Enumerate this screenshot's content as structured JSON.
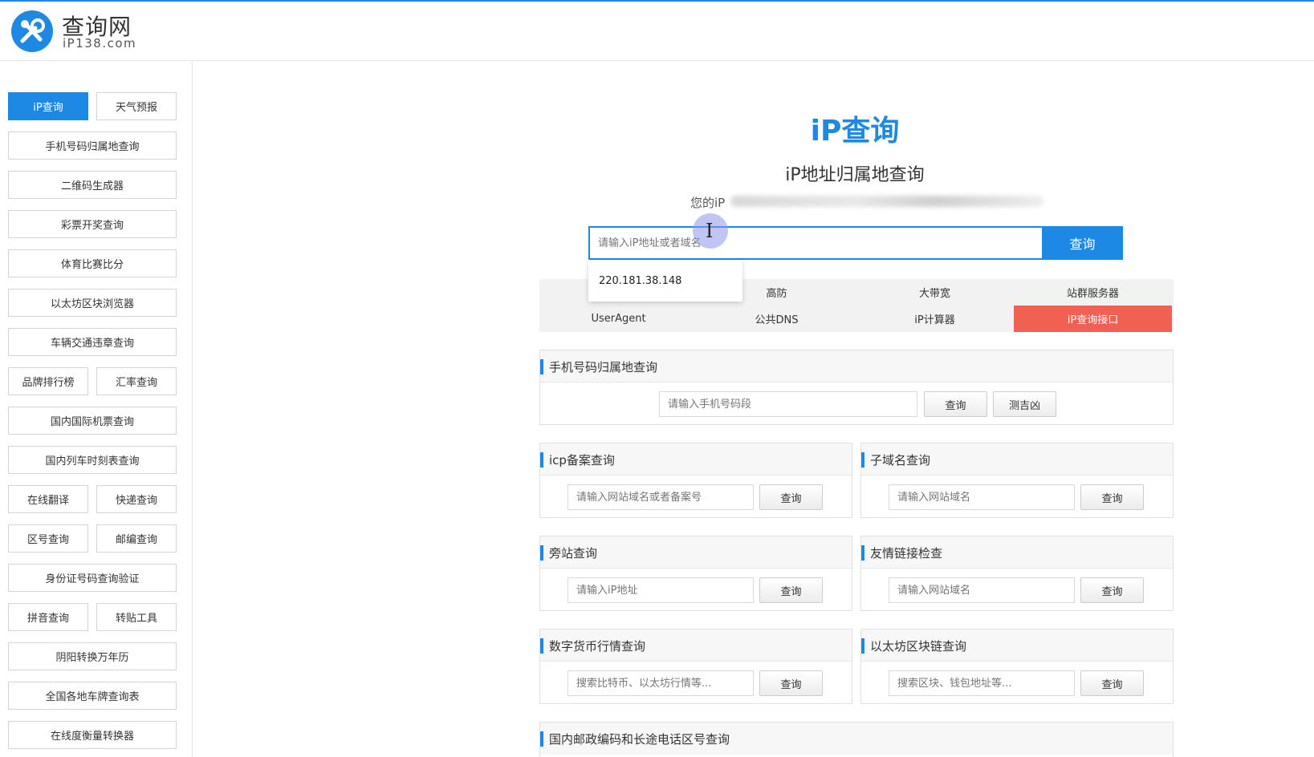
{
  "colors": {
    "accent": "#1e88e5",
    "highlight": "#f16152"
  },
  "header": {
    "site_name": "查询网",
    "site_domain": "iP138.com"
  },
  "sidebar": {
    "items": [
      {
        "label": "iP查询",
        "active": true
      },
      {
        "label": "天气预报"
      },
      {
        "label": "手机号码归属地查询"
      },
      {
        "label": "二维码生成器"
      },
      {
        "label": "彩票开奖查询"
      },
      {
        "label": "体育比赛比分"
      },
      {
        "label": "以太坊区块浏览器"
      },
      {
        "label": "车辆交通违章查询"
      },
      {
        "label": "品牌排行榜"
      },
      {
        "label": "汇率查询"
      },
      {
        "label": "国内国际机票查询"
      },
      {
        "label": "国内列车时刻表查询"
      },
      {
        "label": "在线翻译"
      },
      {
        "label": "快递查询"
      },
      {
        "label": "区号查询"
      },
      {
        "label": "邮编查询"
      },
      {
        "label": "身份证号码查询验证"
      },
      {
        "label": "拼音查询"
      },
      {
        "label": "转贴工具"
      },
      {
        "label": "阴阳转换万年历"
      },
      {
        "label": "全国各地车牌查询表"
      },
      {
        "label": "在线度衡量转换器"
      }
    ]
  },
  "main": {
    "title": "iP查询",
    "subtitle": "iP地址归属地查询",
    "your_ip_label": "您的iP",
    "search": {
      "placeholder": "请输入iP地址或者域名",
      "value": "",
      "button": "查询"
    },
    "suggestion": "220.181.38.148",
    "quick_links": {
      "row1": [
        "高防",
        "大带宽",
        "站群服务器"
      ],
      "row2": [
        "UserAgent",
        "公共DNS",
        "iP计算器",
        "iP查询接口"
      ]
    },
    "panels": {
      "phone": {
        "title": "手机号码归属地查询",
        "placeholder": "请输入手机号码段",
        "btn1": "查询",
        "btn2": "测吉凶"
      },
      "icp": {
        "title": "icp备案查询",
        "placeholder": "请输入网站域名或者备案号",
        "btn": "查询"
      },
      "subdomain": {
        "title": "子域名查询",
        "placeholder": "请输入网站域名",
        "btn": "查询"
      },
      "sidesite": {
        "title": "旁站查询",
        "placeholder": "请输入iP地址",
        "btn": "查询"
      },
      "links": {
        "title": "友情链接检查",
        "placeholder": "请输入网站域名",
        "btn": "查询"
      },
      "crypto": {
        "title": "数字货币行情查询",
        "placeholder": "搜索比特币、以太坊行情等...",
        "btn": "查询"
      },
      "eth": {
        "title": "以太坊区块链查询",
        "placeholder": "搜索区块、钱包地址等...",
        "btn": "查询"
      },
      "postal": {
        "title": "国内邮政编码和长途电话区号查询"
      }
    }
  }
}
